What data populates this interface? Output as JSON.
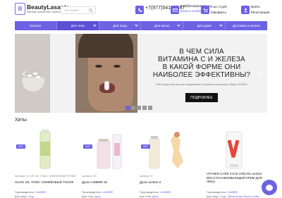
{
  "header": {
    "logo_letter": "B",
    "brand": "BeautyLasante",
    "tagline": "Магазин косметики Lambre",
    "search_placeholder": "Что ищем?",
    "phone": "+7(977)541-92-87",
    "email": "mail@beautylasante.ru",
    "cashback": "вернуть кешбэк",
    "cart_sum": "0 шт. 0 руб.",
    "checkout": "Оформить",
    "login": "Войти",
    "register": "Регистрация"
  },
  "nav": {
    "items": [
      {
        "label": "Каталог",
        "active": false
      },
      {
        "label": "Для тела",
        "active": true
      },
      {
        "label": "Для лица",
        "active": false
      },
      {
        "label": "Для волос",
        "active": false
      },
      {
        "label": "Для дома",
        "active": false
      },
      {
        "label": "Доставка и оплата",
        "active": false
      }
    ]
  },
  "banner": {
    "title": "В ЧЕМ СИЛА\nВИТАМИНА С И ЖЕЛЕЗА\nВ КАКОЙ ФОРМЕ ОНИ\nНАИБОЛЕЕ ЭФФЕКТИВНЫ?",
    "subtitle": "Рей эксуросие высока эффекимон в рамках материала Mega VITAKA",
    "button": "ПОДРОБНЕЕ"
  },
  "hits": {
    "title": "Хиты",
    "products": [
      {
        "badge": "ХИТ",
        "article": "Артикул: OLIVE OIL TONIC ОЛИВКОВЫЙ ТОНИК",
        "name": "OLIVE OIL TONIC ОЛИВКОВЫЙ ТОНИК",
        "manufacturer_label": "Производитель:",
        "manufacturer": "LAMBRE",
        "category_label": "Для лица:",
        "category": "Уход"
      },
      {
        "badge": "ХИТ",
        "article": "Артикул: 55",
        "name": "Духи LAMBRE 55",
        "manufacturer_label": "Производитель:",
        "manufacturer": "LAMBRE",
        "category_label": "Для тела:",
        "category": "Духи"
      },
      {
        "badge": "ХИТ",
        "article": "Артикул: 6",
        "name": "Духи Lambre 6",
        "manufacturer_label": "Производитель:",
        "manufacturer": "LAMBRE",
        "category_label": "Для тела:",
        "category": "Духи"
      },
      {
        "badge": "",
        "article": "",
        "name": "VITAMIN CARE FACE CREAM Lambre ВОССТАНАВЛИВАЮЩИЙ КРЕМ ДЛЯ ЛИЦА",
        "manufacturer_label": "Производитель:",
        "manufacturer": "LAMBRE",
        "category_label": "Для лица:",
        "category": "Уход, Обновление Кожи головы"
      }
    ]
  },
  "colors": {
    "accent": "#6c63e4",
    "button": "#111111"
  }
}
